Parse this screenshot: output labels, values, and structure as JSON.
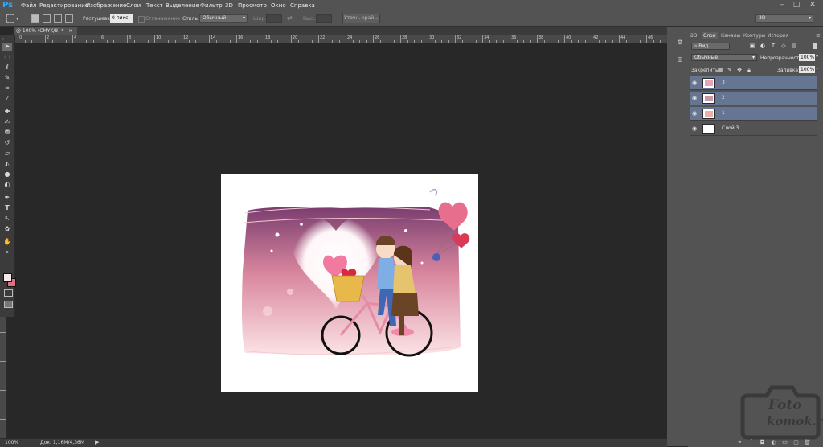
{
  "app": {
    "logo": "Ps"
  },
  "menu": [
    "Файл",
    "Редактирование",
    "Изображение",
    "Слои",
    "Текст",
    "Выделение",
    "Фильтр",
    "3D",
    "Просмотр",
    "Окно",
    "Справка"
  ],
  "window_controls": [
    "–",
    "□",
    "✕"
  ],
  "options_bar": {
    "feather_label": "Растушевка:",
    "feather_value": "0 пикс.",
    "antialias_label": "Сглаживание",
    "style_label": "Стиль:",
    "style_value": "Обычный",
    "width_label": "Шир.:",
    "height_label": "Выс.:",
    "refine_button": "Уточн. край...",
    "workspace_value": "3D"
  },
  "document_tab": {
    "title": "@ 100% (CMYK/8) *",
    "close": "×"
  },
  "ruler": {
    "labels": [
      "0",
      "2",
      "4",
      "6",
      "8",
      "10",
      "12",
      "14",
      "16",
      "18",
      "20",
      "22",
      "24",
      "26",
      "28",
      "30",
      "32",
      "34",
      "36",
      "38",
      "40",
      "42",
      "44",
      "46"
    ]
  },
  "tools": [
    {
      "icon": "move-tool-icon",
      "glyph": "➤"
    },
    {
      "icon": "marquee-tool-icon",
      "glyph": "⬚"
    },
    {
      "icon": "lasso-tool-icon",
      "glyph": "ℓ"
    },
    {
      "icon": "quick-select-tool-icon",
      "glyph": "✎"
    },
    {
      "icon": "crop-tool-icon",
      "glyph": "⌗"
    },
    {
      "icon": "eyedropper-tool-icon",
      "glyph": "⁄"
    },
    {
      "icon": "healing-brush-tool-icon",
      "glyph": "✚"
    },
    {
      "icon": "brush-tool-icon",
      "glyph": "✍"
    },
    {
      "icon": "clone-stamp-tool-icon",
      "glyph": "⛃"
    },
    {
      "icon": "history-brush-tool-icon",
      "glyph": "↺"
    },
    {
      "icon": "eraser-tool-icon",
      "glyph": "▱"
    },
    {
      "icon": "paint-bucket-tool-icon",
      "glyph": "◭"
    },
    {
      "icon": "blur-tool-icon",
      "glyph": "●"
    },
    {
      "icon": "dodge-tool-icon",
      "glyph": "◐"
    },
    {
      "icon": "pen-tool-icon",
      "glyph": "✒"
    },
    {
      "icon": "type-tool-icon",
      "glyph": "T"
    },
    {
      "icon": "path-select-tool-icon",
      "glyph": "↖"
    },
    {
      "icon": "shape-tool-icon",
      "glyph": "✿"
    },
    {
      "icon": "hand-tool-icon",
      "glyph": "✋"
    },
    {
      "icon": "zoom-tool-icon",
      "glyph": "⌕"
    }
  ],
  "colors": {
    "foreground": "#f6e9e9",
    "background": "#e06e86",
    "selection": "#657592",
    "panel": "#535353",
    "canvas": "#282828"
  },
  "status": {
    "zoom": "100%",
    "doc_info": "Док: 1,16M/4,36M"
  },
  "panel_tabs": [
    "3D",
    "Слои",
    "Каналы",
    "Контуры",
    "История"
  ],
  "layers_panel": {
    "filter_label": "Вид",
    "blend_mode": "Обычные",
    "opacity_label": "Непрозрачность:",
    "opacity_value": "100%",
    "lock_label": "Закрепить:",
    "fill_label": "Заливка:",
    "fill_value": "100%",
    "layers": [
      {
        "name": "3",
        "selected": true
      },
      {
        "name": "2",
        "selected": true
      },
      {
        "name": "1",
        "selected": true
      },
      {
        "name": "Слой 3",
        "selected": false
      }
    ]
  },
  "watermark": {
    "line1": "Foto",
    "line2": "komok.ru"
  }
}
